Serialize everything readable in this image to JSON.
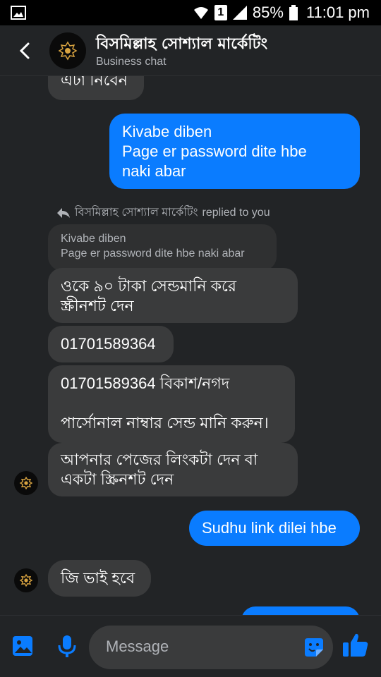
{
  "status_bar": {
    "sim": "1",
    "battery": "85%",
    "time": "11:01 pm"
  },
  "header": {
    "title": "বিসমিল্লাহ সোশ্যাল মার্কেটিং",
    "subtitle": "Business chat"
  },
  "messages": {
    "m0": "এটা নিবেন",
    "m1": "Kivabe diben\nPage er password dite hbe\nnaki abar",
    "reply_name": "বিসমিল্লাহ সোশ্যাল মার্কেটিং",
    "reply_suffix": "replied to you",
    "quoted": "Kivabe diben\nPage er password dite hbe naki abar",
    "m2": "ওকে ৯০ টাকা সেন্ডমানি করে\nস্ক্রীনশট দেন",
    "m3": "01701589364",
    "m4": "01701589364 বিকাশ/নগদ\n\nপার্সোনাল নাম্বার সেন্ড মানি করুন।",
    "m5": "আপনার পেজের লিংকটা দেন বা\nএকটা স্ক্রিনশট দেন",
    "m6": "Sudhu link dilei hbe",
    "m7": "জি ভাই হবে"
  },
  "composer": {
    "placeholder": "Message"
  },
  "colors": {
    "background": "#222426",
    "incoming": "#3a3b3c",
    "outgoing": "#0a7cff",
    "accent": "#0a7cff"
  },
  "icons": [
    "back-icon",
    "image-icon",
    "mic-icon",
    "sticker-icon",
    "like-icon",
    "reply-arrow-icon"
  ]
}
